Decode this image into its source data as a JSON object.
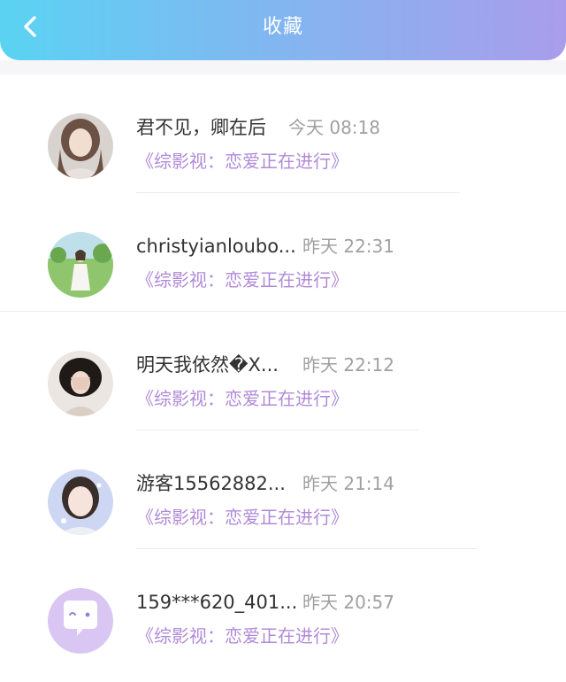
{
  "header": {
    "title": "收藏",
    "back_icon": "chevron-left-icon",
    "gradient": [
      "#5ad3f2",
      "#a99deb"
    ]
  },
  "favorites": [
    {
      "user": "君不见，卿在后",
      "time": "今天 08:18",
      "show": "《综影视：恋爱正在进行》",
      "avatar": "user-photo"
    },
    {
      "user": "christyianloubo...",
      "time": "昨天 22:31",
      "show": "《综影视：恋爱正在进行》",
      "avatar": "user-photo"
    },
    {
      "user": "明天我依然�X...",
      "time": "昨天 22:12",
      "show": "《综影视：恋爱正在进行》",
      "avatar": "user-photo"
    },
    {
      "user": "游客15562882...",
      "time": "昨天 21:14",
      "show": "《综影视：恋爱正在进行》",
      "avatar": "user-photo"
    },
    {
      "user": "159***620_401...",
      "time": "昨天 20:57",
      "show": "《综影视：恋爱正在进行》",
      "avatar": "default-chat-bubble"
    }
  ],
  "colors": {
    "show_title": "#b18ad8",
    "default_avatar_bg": "#d9c6f3"
  }
}
